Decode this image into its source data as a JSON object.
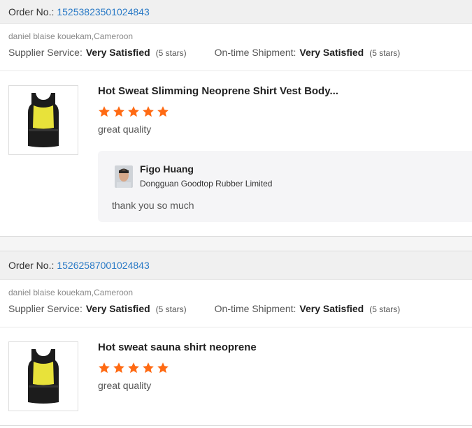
{
  "orders": [
    {
      "order_label": "Order No.:",
      "order_number": "15253823501024843",
      "buyer": "daniel blaise kouekam,Cameroon",
      "supplier_service_label": "Supplier Service:",
      "supplier_service_value": "Very Satisfied",
      "supplier_service_stars": "(5 stars)",
      "shipment_label": "On-time Shipment:",
      "shipment_value": "Very Satisfied",
      "shipment_stars": "(5 stars)",
      "product_title": "Hot Sweat Slimming Neoprene Shirt Vest Body...",
      "rating": 5,
      "review": "great quality",
      "reply": {
        "name": "Figo Huang",
        "company": "Dongguan Goodtop Rubber Limited",
        "text": "thank you so much"
      }
    },
    {
      "order_label": "Order No.:",
      "order_number": "15262587001024843",
      "buyer": "daniel blaise kouekam,Cameroon",
      "supplier_service_label": "Supplier Service:",
      "supplier_service_value": "Very Satisfied",
      "supplier_service_stars": "(5 stars)",
      "shipment_label": "On-time Shipment:",
      "shipment_value": "Very Satisfied",
      "shipment_stars": "(5 stars)",
      "product_title": "Hot sweat sauna shirt neoprene",
      "rating": 5,
      "review": "great quality"
    }
  ],
  "colors": {
    "link": "#2a7ac6",
    "star": "#ff6a13",
    "header_bg": "#f0f0f0",
    "reply_bg": "#f5f5f7"
  },
  "icons": {
    "star": "star-icon",
    "product": "product-thumbnail",
    "avatar": "avatar"
  }
}
